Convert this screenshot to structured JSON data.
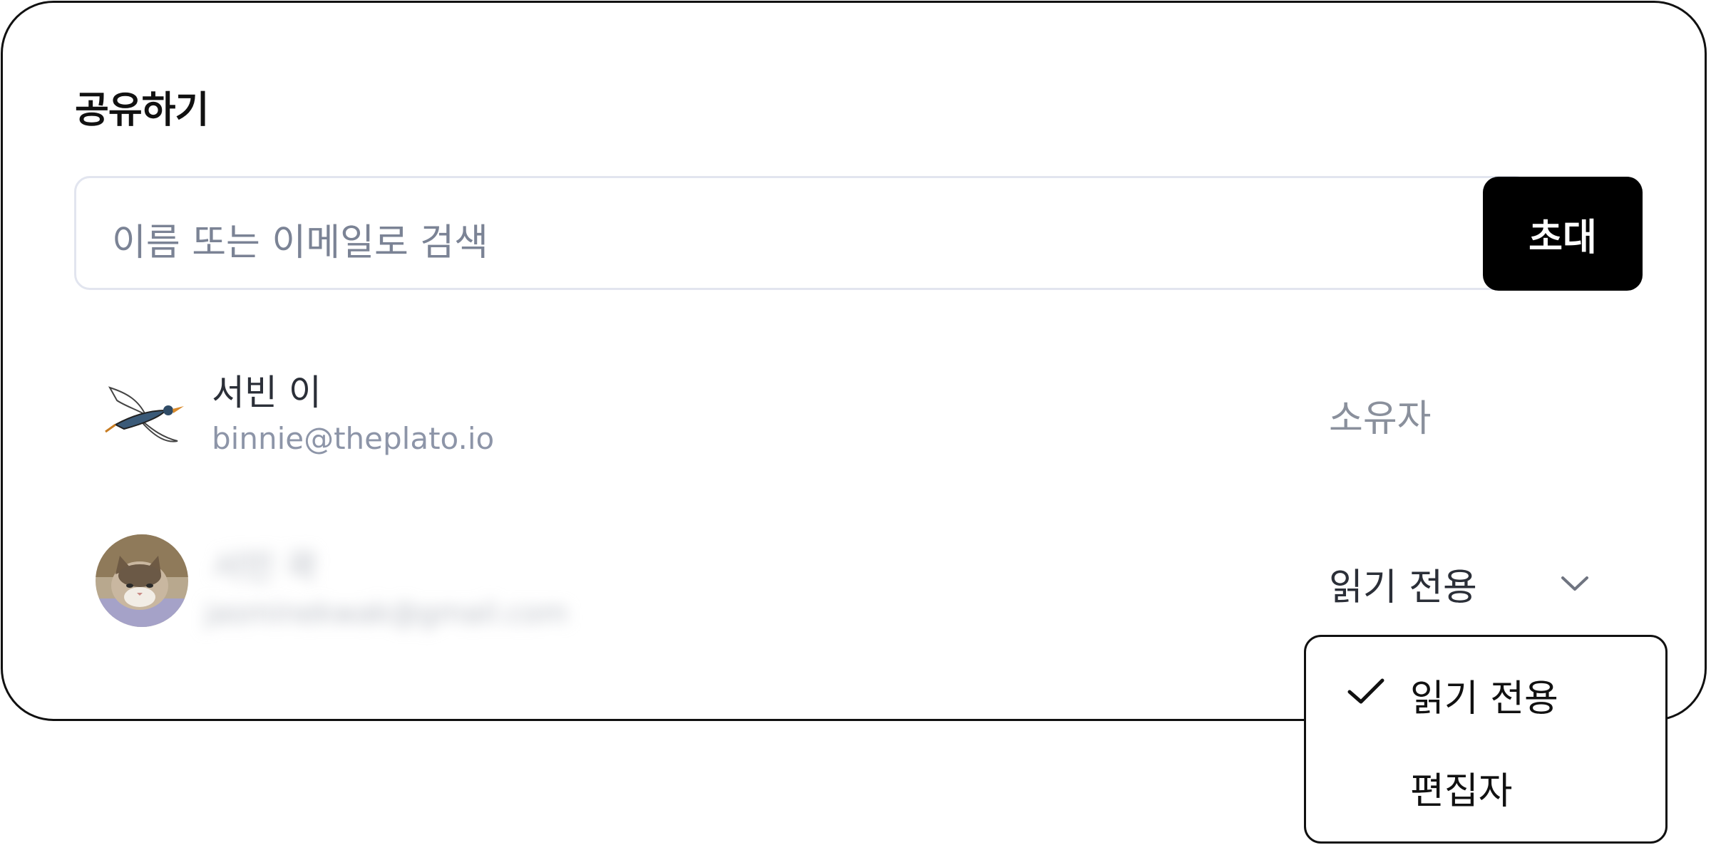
{
  "dialog": {
    "title": "공유하기",
    "search": {
      "placeholder": "이름 또는 이메일로 검색"
    },
    "invite_label": "초대"
  },
  "members": [
    {
      "name": "서빈 이",
      "email": "binnie@theplato.io",
      "role": "소유자",
      "avatar_icon": "bird-illustration-icon"
    },
    {
      "name": "서민 곽",
      "email": "jasminekwak@gmail.com",
      "role": "읽기 전용",
      "avatar_icon": "cat-photo-avatar",
      "redacted": true
    }
  ],
  "role_menu": {
    "items": [
      {
        "label": "읽기 전용",
        "selected": true
      },
      {
        "label": "편집자",
        "selected": false
      }
    ]
  },
  "colors": {
    "border": "#111111",
    "input_border": "#e2e5ef",
    "placeholder": "#7b8395",
    "muted": "#8d95a8",
    "button_bg": "#000000",
    "button_text": "#ffffff"
  }
}
